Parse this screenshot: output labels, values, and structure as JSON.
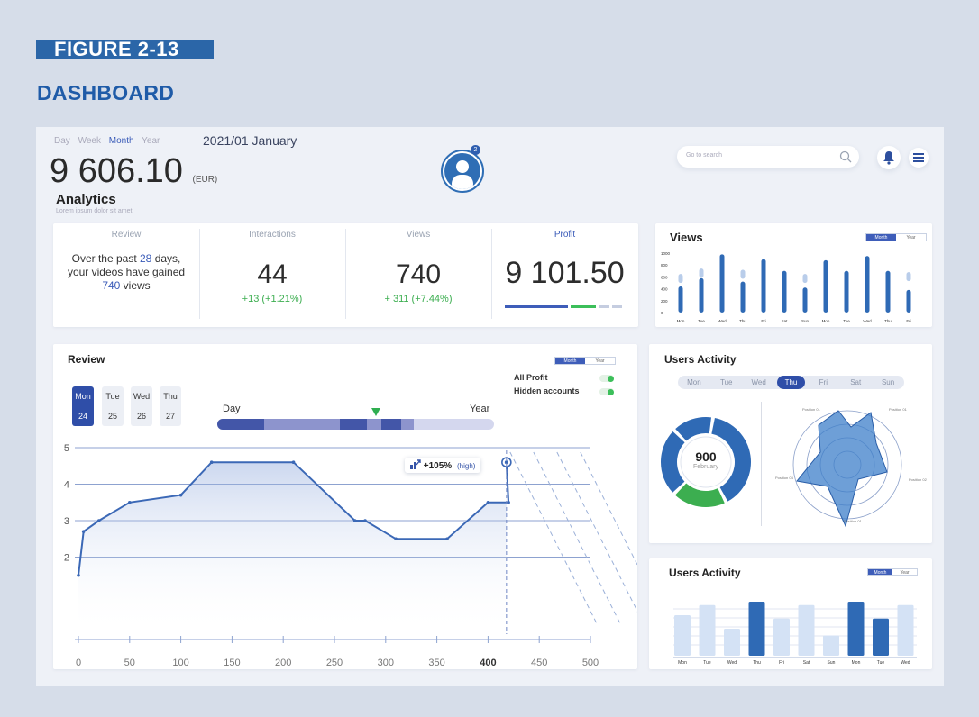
{
  "figure": {
    "label": "FIGURE 2-13",
    "title": "DASHBOARD"
  },
  "header": {
    "periods": [
      "Day",
      "Week",
      "Month",
      "Year"
    ],
    "active_period": "Month",
    "date": "2021/01  January",
    "total_value": "9 606.10",
    "currency": "(EUR)",
    "section_title": "Analytics",
    "section_subtitle": "Lorem ipsum dolor sit amet",
    "avatar_badge": "2",
    "search_placeholder": "Go to search"
  },
  "kpis": {
    "review": {
      "head": "Review",
      "text_a": "Over the past ",
      "days": "28",
      "text_b": " days, your videos have gained ",
      "count": "740",
      "text_c": " views"
    },
    "interactions": {
      "head": "Interactions",
      "value": "44",
      "delta": "+13 (+1.21%)"
    },
    "views": {
      "head": "Views",
      "value": "740",
      "delta": "+ 311 (+7.44%)"
    },
    "profit": {
      "head": "Profit",
      "value": "9 101.50"
    }
  },
  "views_chart": {
    "title": "Views",
    "tabs": [
      "Month",
      "Year"
    ],
    "y_ticks": [
      "1000",
      "800",
      "600",
      "400",
      "200",
      "0"
    ],
    "days": [
      "Mon",
      "Tue",
      "Wed",
      "Thu",
      "Fri",
      "Sat",
      "Sun",
      "Mon",
      "Tue",
      "Wed",
      "Thu",
      "Fri"
    ]
  },
  "review": {
    "title": "Review",
    "tabs": [
      "Month",
      "Year"
    ],
    "days": [
      {
        "name": "Mon",
        "num": "24"
      },
      {
        "name": "Tue",
        "num": "25"
      },
      {
        "name": "Wed",
        "num": "26"
      },
      {
        "name": "Thu",
        "num": "27"
      }
    ],
    "slider_left": "Day",
    "slider_right": "Year",
    "toggle_1": "All Profit",
    "toggle_2": "Hidden accounts",
    "callout_value": "+105%",
    "callout_note": "(high)"
  },
  "users_activity_1": {
    "title": "Users Activity",
    "days": [
      "Mon",
      "Tue",
      "Wed",
      "Thu",
      "Fri",
      "Sat",
      "Sun"
    ],
    "active_day": "Thu",
    "donut_value": "900",
    "donut_label": "February",
    "radar_labels": [
      "Position 01",
      "Position 01",
      "Position 02",
      "Position 01",
      "Position 04"
    ]
  },
  "users_activity_2": {
    "title": "Users Activity",
    "tabs": [
      "Month",
      "Year"
    ],
    "days": [
      "Mon",
      "Tue",
      "Wed",
      "Thu",
      "Fri",
      "Sat",
      "Sun",
      "Mon",
      "Tue",
      "Wed"
    ]
  },
  "chart_data": [
    {
      "type": "line",
      "title": "Review",
      "x": [
        0,
        5,
        20,
        50,
        100,
        130,
        210,
        270,
        280,
        310,
        360,
        400,
        420,
        418
      ],
      "y": [
        1.5,
        2.7,
        3.0,
        3.5,
        3.7,
        4.6,
        4.6,
        3.0,
        3.0,
        2.5,
        2.5,
        3.5,
        3.5,
        4.6
      ],
      "xlim": [
        0,
        500
      ],
      "ylim": [
        1,
        5
      ],
      "x_ticks": [
        "0",
        "50",
        "100",
        "150",
        "200",
        "250",
        "300",
        "350",
        "400",
        "450",
        "500"
      ],
      "y_ticks": [
        "2",
        "3",
        "4",
        "5"
      ],
      "grid": true
    },
    {
      "type": "bar",
      "title": "Views",
      "categories": [
        "Mon",
        "Tue",
        "Wed",
        "Thu",
        "Fri",
        "Sat",
        "Sun",
        "Mon",
        "Tue",
        "Wed",
        "Thu",
        "Fri"
      ],
      "series": [
        {
          "values": [
            440,
            580,
            980,
            520,
            900,
            700,
            420,
            880,
            700,
            950,
            700,
            380
          ]
        },
        {
          "values": [
            650,
            740,
            980,
            720,
            900,
            700,
            650,
            880,
            700,
            950,
            700,
            680
          ]
        }
      ],
      "ylim": [
        0,
        1000
      ]
    },
    {
      "type": "pie",
      "title": "Users Activity",
      "values": [
        40,
        20,
        25,
        15
      ],
      "center_value": "900"
    },
    {
      "type": "bar",
      "title": "Users Activity",
      "categories": [
        "Mon",
        "Tue",
        "Wed",
        "Thu",
        "Fri",
        "Sat",
        "Sun",
        "Mon",
        "Tue",
        "Wed"
      ],
      "values": [
        60,
        75,
        40,
        80,
        55,
        75,
        30,
        80,
        55,
        75
      ],
      "highlight": [
        false,
        false,
        false,
        true,
        false,
        false,
        false,
        true,
        true,
        false
      ]
    }
  ]
}
